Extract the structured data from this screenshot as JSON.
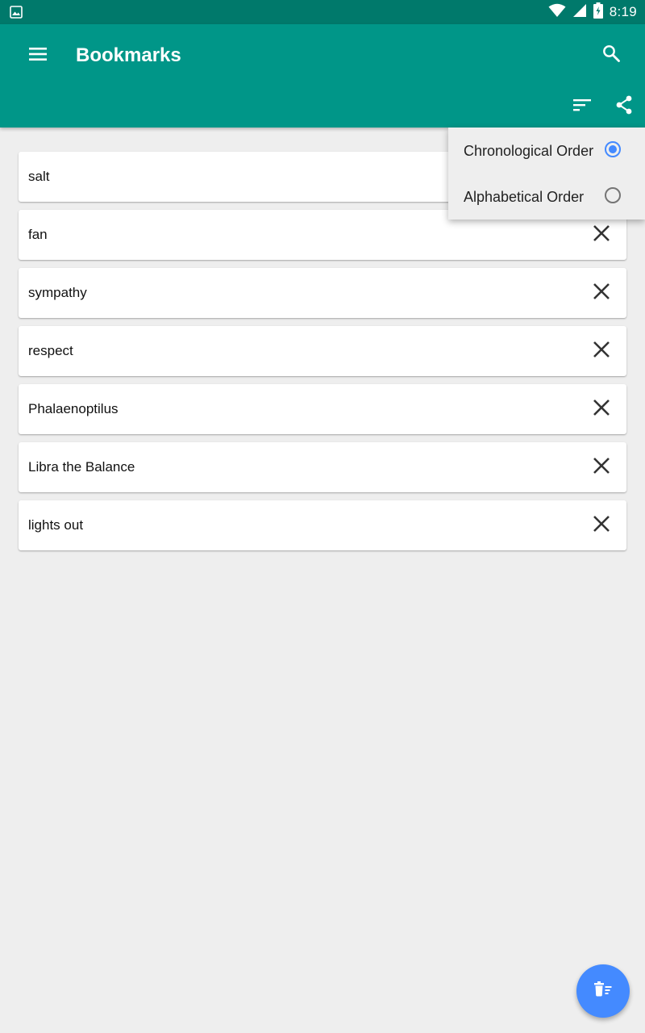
{
  "status_bar": {
    "time": "8:19",
    "icons": [
      "image-notification-icon",
      "wifi-icon",
      "signal-icon",
      "battery-charging-icon"
    ]
  },
  "app_bar": {
    "title": "Bookmarks",
    "color": "#009688",
    "icons": [
      "menu-icon",
      "search-icon",
      "sort-icon",
      "share-icon"
    ]
  },
  "bookmarks": [
    {
      "label": "salt"
    },
    {
      "label": "fan"
    },
    {
      "label": "sympathy"
    },
    {
      "label": "respect"
    },
    {
      "label": "Phalaenoptilus"
    },
    {
      "label": "Libra the Balance"
    },
    {
      "label": "lights out"
    }
  ],
  "sort_menu": {
    "options": [
      {
        "label": "Chronological Order",
        "selected": true
      },
      {
        "label": "Alphabetical Order",
        "selected": false
      }
    ],
    "accent": "#448aff"
  },
  "fab": {
    "icon": "delete-all-icon",
    "color": "#448aff"
  }
}
